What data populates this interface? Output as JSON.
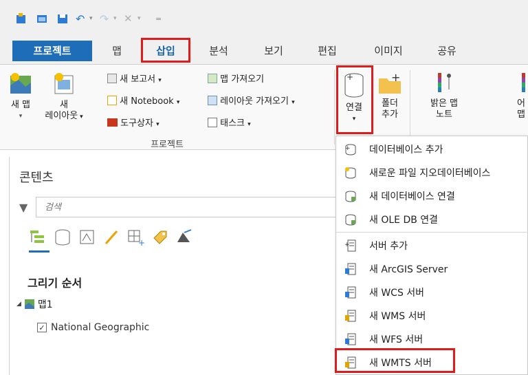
{
  "tabs": {
    "project": "프로젝트",
    "map": "맵",
    "insert": "삽입",
    "analysis": "분석",
    "view": "보기",
    "edit": "편집",
    "imagery": "이미지",
    "share": "공유"
  },
  "ribbon": {
    "new_map": "새 맵",
    "new_layout_line1": "새",
    "new_layout_line2": "레이아웃",
    "new_report": "새 보고서",
    "new_notebook": "새 Notebook",
    "toolbox": "도구상자",
    "import_map": "맵 가져오기",
    "import_layout": "레이아웃 가져오기",
    "tasks": "태스크",
    "connect": "연결",
    "add_folder_line1": "폴더",
    "add_folder_line2": "추가",
    "light_map_line1": "밝은 맵",
    "light_map_line2": "노트",
    "dark_map_line1": "어",
    "dark_map_line2": "맵",
    "group_project": "프로젝트"
  },
  "contents": {
    "title": "콘텐츠",
    "search_placeholder": "검색",
    "draw_order": "그리기 순서",
    "map_name": "맵1",
    "layer_name": "National Geographic"
  },
  "menu": {
    "items": [
      {
        "label": "데이터베이스 추가",
        "icon": "add-database-icon"
      },
      {
        "label": "새로운 파일 지오데이터베이스",
        "icon": "new-file-geodatabase-icon"
      },
      {
        "label": "새 데이터베이스 연결",
        "icon": "new-database-connection-icon"
      },
      {
        "label": "새 OLE DB 연결",
        "icon": "new-ole-db-connection-icon"
      },
      {
        "label": "서버 추가",
        "icon": "add-server-icon"
      },
      {
        "label": "새 ArcGIS Server",
        "icon": "arcgis-server-icon"
      },
      {
        "label": "새 WCS 서버",
        "icon": "wcs-server-icon"
      },
      {
        "label": "새 WMS 서버",
        "icon": "wms-server-icon"
      },
      {
        "label": "새 WFS 서버",
        "icon": "wfs-server-icon"
      },
      {
        "label": "새 WMTS 서버",
        "icon": "wmts-server-icon"
      }
    ]
  },
  "colors": {
    "accent": "#1e6db8",
    "highlight_box": "#e01b1b"
  }
}
